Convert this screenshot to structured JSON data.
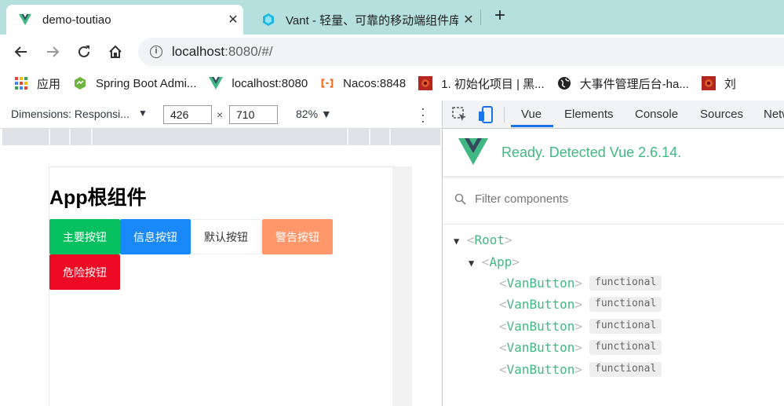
{
  "browser": {
    "tabs": [
      {
        "title": "demo-toutiao",
        "active": true,
        "favicon": "vue-logo-icon"
      },
      {
        "title": "Vant - 轻量、可靠的移动端组件库",
        "active": false,
        "favicon": "vant-logo-icon"
      }
    ],
    "close_glyph": "✕",
    "new_tab_glyph": "+",
    "url": {
      "host": "localhost",
      "rest": ":8080/#/"
    },
    "bookmarks": [
      {
        "label": "应用",
        "icon": "apps-grid-icon"
      },
      {
        "label": "Spring Boot Admi...",
        "icon": "spring-boot-icon"
      },
      {
        "label": "localhost:8080",
        "icon": "vue-logo-icon"
      },
      {
        "label": "Nacos:8848",
        "icon": "nacos-icon"
      },
      {
        "label": "1. 初始化项目 | 黑...",
        "icon": "heima-icon"
      },
      {
        "label": "大事件管理后台-ha...",
        "icon": "globe-icon"
      },
      {
        "label": "刘",
        "icon": "heima-icon"
      }
    ]
  },
  "device_toolbar": {
    "dimensions_label": "Dimensions: Responsi...",
    "width": "426",
    "height": "710",
    "times": "×",
    "zoom": "82% ▼",
    "arrow": "▼"
  },
  "page": {
    "title": "App根组件",
    "buttons": [
      {
        "label": "主要按钮",
        "type": "primary",
        "bg": "#07c160"
      },
      {
        "label": "信息按钮",
        "type": "info",
        "bg": "#1989fa"
      },
      {
        "label": "默认按钮",
        "type": "default",
        "bg": "#ffffff"
      },
      {
        "label": "警告按钮",
        "type": "warning",
        "bg": "#ff976a"
      },
      {
        "label": "危险按钮",
        "type": "danger",
        "bg": "#ee0a24"
      }
    ]
  },
  "devtools": {
    "tabs": [
      "Vue",
      "Elements",
      "Console",
      "Sources",
      "Netw"
    ],
    "ready_text": "Ready. Detected Vue 2.6.14.",
    "filter_placeholder": "Filter components",
    "tree": {
      "root": "Root",
      "app": "App",
      "children": [
        {
          "name": "VanButton",
          "badge": "functional"
        },
        {
          "name": "VanButton",
          "badge": "functional"
        },
        {
          "name": "VanButton",
          "badge": "functional"
        },
        {
          "name": "VanButton",
          "badge": "functional"
        },
        {
          "name": "VanButton",
          "badge": "functional"
        }
      ]
    }
  }
}
